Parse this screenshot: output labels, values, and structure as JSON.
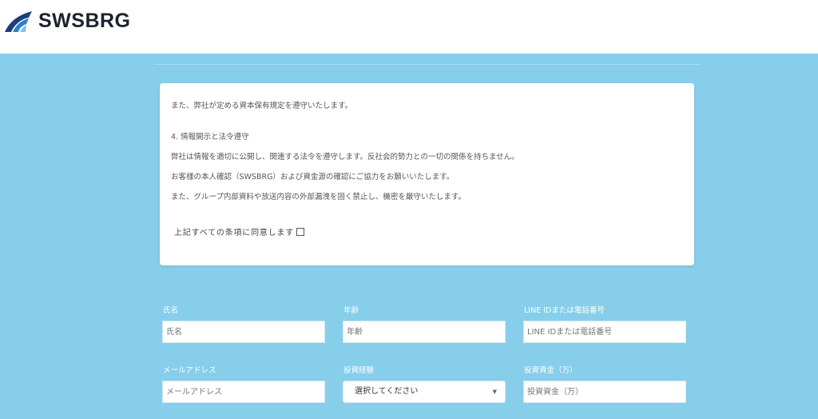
{
  "header": {
    "logo_text": "SWSBRG",
    "brand_color": "#1e5fa8"
  },
  "terms": {
    "lines": [
      "また、弊社が定める資本保有規定を遵守いたします。",
      "4. 情報開示と法令遵守",
      "弊社は情報を適切に公開し、関連する法令を遵守します。反社会的勢力との一切の関係を持ちません。",
      "お客様の本人確認（SWSBRG）および資金源の確認にご協力をお願いいたします。",
      "また、グループ内部資料や放送内容の外部漏洩を固く禁止し、機密を厳守いたします。"
    ],
    "agree_label": "上記すべての条項に同意します",
    "agree_checked": false
  },
  "form": {
    "name": {
      "label": "氏名",
      "placeholder": "氏名"
    },
    "age": {
      "label": "年齢",
      "placeholder": "年齢"
    },
    "contact": {
      "label": "LINE IDまたは電話番号",
      "placeholder": "LINE IDまたは電話番号"
    },
    "email": {
      "label": "メールアドレス",
      "placeholder": "メールアドレス"
    },
    "experience": {
      "label": "投資経験",
      "selected": "選択してください"
    },
    "funds": {
      "label": "投資資金（万）",
      "placeholder": "投資資金（万）"
    }
  },
  "colors": {
    "background": "#87ceeb",
    "card": "#ffffff",
    "label_text": "#ffffff"
  }
}
